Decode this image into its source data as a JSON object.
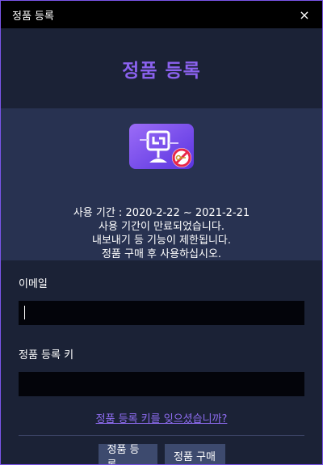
{
  "window": {
    "title": "정품 등록",
    "close_glyph": "×"
  },
  "heading": "정품 등록",
  "app_icon": {
    "name": "app-icon",
    "badge": "no-key-icon"
  },
  "info": {
    "period": "사용 기간 : 2020-2-22 ~ 2021-2-21",
    "expired": "사용 기간이 만료되었습니다.",
    "limited": "내보내기 등 기능이 제한됩니다.",
    "buy": "정품 구매 후 사용하십시오."
  },
  "form": {
    "email_label": "이메일",
    "email_value": "",
    "key_label": "정품 등록 키",
    "key_value": "",
    "forgot_link": "정품 등록 키를 잊으셨습니까?"
  },
  "buttons": {
    "register": "정품 등록",
    "purchase": "정품 구매"
  },
  "colors": {
    "accent": "#8b62ef",
    "background": "#1b2236",
    "panel": "#283251",
    "button": "#3d4a6e"
  }
}
